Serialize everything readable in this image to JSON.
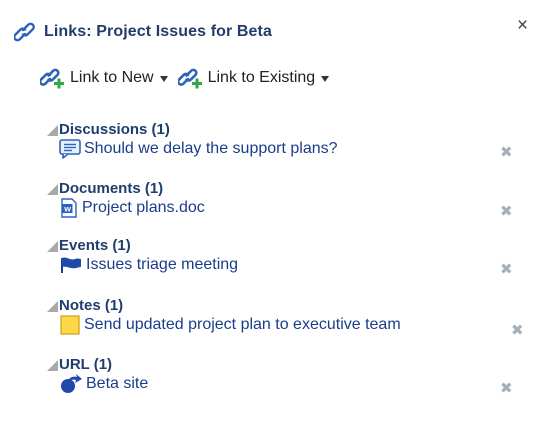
{
  "header": {
    "title": "Links: Project Issues for Beta",
    "close_glyph": "×"
  },
  "toolbar": {
    "link_new": "Link to New",
    "link_existing": "Link to Existing"
  },
  "sections": [
    {
      "title": "Discussions (1)",
      "item": "Should we delay the support plans?",
      "icon": "discussion-icon"
    },
    {
      "title": "Documents (1)",
      "item": "Project plans.doc",
      "icon": "word-doc-icon"
    },
    {
      "title": "Events (1)",
      "item": "Issues triage meeting",
      "icon": "flag-icon"
    },
    {
      "title": "Notes (1)",
      "item": "Send updated project plan to executive team",
      "icon": "note-icon"
    },
    {
      "title": "URL (1)",
      "item": "Beta site",
      "icon": "url-arrow-icon"
    }
  ],
  "remove_glyph": "✖",
  "colors": {
    "title": "#233d6b",
    "link": "#1a3d8a",
    "remove": "#a4b0bc",
    "triangle": "#a9a9a9"
  }
}
